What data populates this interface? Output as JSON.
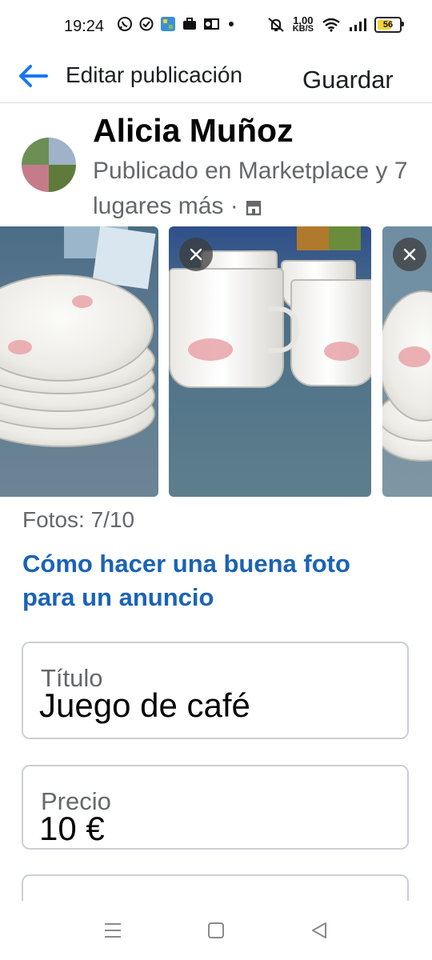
{
  "status_bar": {
    "time": "19:24",
    "speed_value": "1,00",
    "speed_unit": "KB/S",
    "battery": "56",
    "icons": [
      "whatsapp-icon",
      "check-circle-icon",
      "app-icon",
      "briefcase-icon",
      "outlook-icon",
      "dot-icon",
      "mute-icon",
      "wifi-icon",
      "signal-icon",
      "battery-icon"
    ]
  },
  "header": {
    "title": "Editar publicación",
    "save_label": "Guardar"
  },
  "profile": {
    "name": "Alicia Muñoz",
    "meta": "Publicado en Marketplace y 7 lugares más ·"
  },
  "photos": {
    "count_label": "Fotos: 7/10",
    "items": [
      {
        "subject": "stacked saucers"
      },
      {
        "subject": "coffee cups"
      },
      {
        "subject": "stacked saucers"
      }
    ]
  },
  "tips_link": "Cómo hacer una buena foto para un anuncio",
  "fields": {
    "title_label": "Título",
    "title_value": "Juego de café",
    "price_label": "Precio",
    "price_value": "10 €"
  },
  "colors": {
    "link": "#1a63b7",
    "back_arrow": "#1877f2",
    "secondary_text": "#65676b",
    "field_border": "#ccd0d5"
  }
}
